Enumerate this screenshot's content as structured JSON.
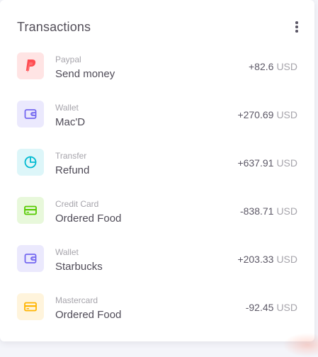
{
  "header": {
    "title": "Transactions"
  },
  "colors": {
    "paypal": "#ff4c51",
    "wallet": "#7367f0",
    "transfer": "#00bad1",
    "credit_card": "#56ca00",
    "mastercard": "#ffb400"
  },
  "transactions": [
    {
      "source": "Paypal",
      "name": "Send money",
      "amount": "+82.6",
      "currency": "USD",
      "icon": "paypal-icon"
    },
    {
      "source": "Wallet",
      "name": "Mac'D",
      "amount": "+270.69",
      "currency": "USD",
      "icon": "wallet-icon"
    },
    {
      "source": "Transfer",
      "name": "Refund",
      "amount": "+637.91",
      "currency": "USD",
      "icon": "pie-chart-icon"
    },
    {
      "source": "Credit Card",
      "name": "Ordered Food",
      "amount": "-838.71",
      "currency": "USD",
      "icon": "credit-card-icon"
    },
    {
      "source": "Wallet",
      "name": "Starbucks",
      "amount": "+203.33",
      "currency": "USD",
      "icon": "wallet-icon"
    },
    {
      "source": "Mastercard",
      "name": "Ordered Food",
      "amount": "-92.45",
      "currency": "USD",
      "icon": "credit-card-icon"
    }
  ]
}
